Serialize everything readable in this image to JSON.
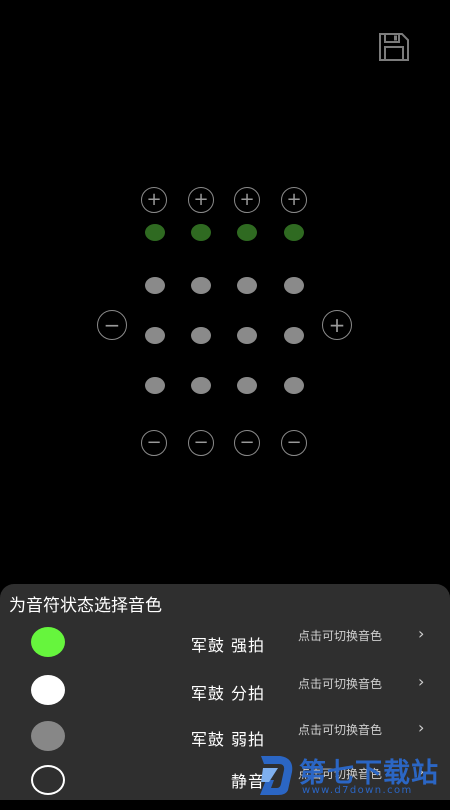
{
  "colors": {
    "accent_green": "#2f6a21",
    "beat_gray": "#8a8a8a",
    "sheet_bg": "#2f2f2f",
    "swatch_green": "#66f53d",
    "swatch_white": "#ffffff",
    "swatch_gray": "#878787",
    "watermark_blue": "#2b66c4"
  },
  "toolbar": {
    "save_icon": "floppy-disk-icon"
  },
  "grid": {
    "add_symbol": "+",
    "remove_symbol": "−",
    "columns": 4,
    "rows": [
      [
        "strong",
        "strong",
        "strong",
        "strong"
      ],
      [
        "weak",
        "weak",
        "weak",
        "weak"
      ],
      [
        "weak",
        "weak",
        "weak",
        "weak"
      ],
      [
        "weak",
        "weak",
        "weak",
        "weak"
      ]
    ]
  },
  "sheet": {
    "title": "为音符状态选择音色",
    "items": [
      {
        "swatch": "green",
        "label": "军鼓 强拍",
        "hint": "点击可切换音色",
        "chevron": "›"
      },
      {
        "swatch": "white",
        "label": "军鼓 分拍",
        "hint": "点击可切换音色",
        "chevron": "›"
      },
      {
        "swatch": "gray",
        "label": "军鼓 弱拍",
        "hint": "点击可切换音色",
        "chevron": "›"
      },
      {
        "swatch": "outline",
        "label": "静音",
        "hint": "点击可切换音色",
        "chevron": "›"
      }
    ]
  },
  "watermark": {
    "title": "第七下载站",
    "url": "www.d7down.com"
  }
}
